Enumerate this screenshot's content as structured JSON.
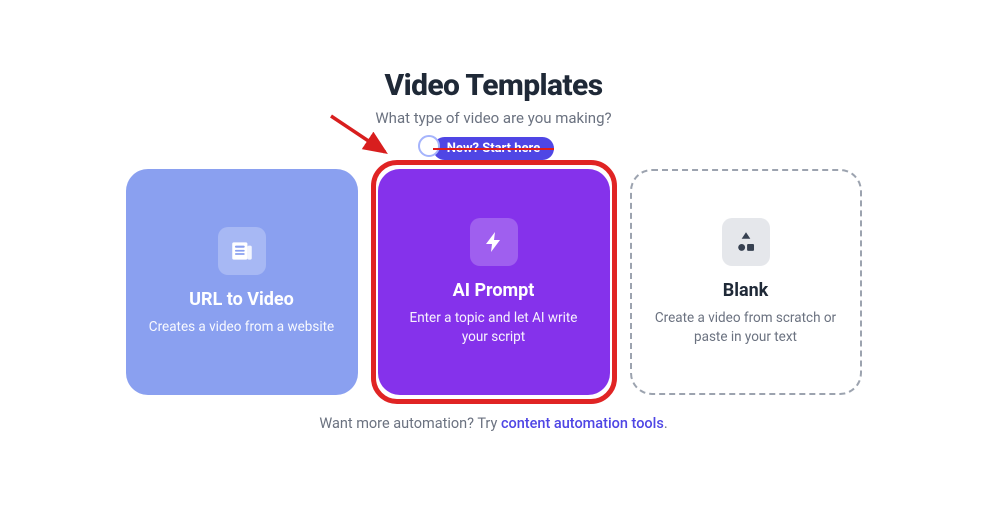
{
  "header": {
    "title": "Video Templates",
    "subtitle": "What type of video are you making?",
    "badge": "New? Start here"
  },
  "cards": {
    "url": {
      "title": "URL to Video",
      "description": "Creates a video from a website",
      "icon": "newspaper-icon"
    },
    "ai": {
      "title": "AI Prompt",
      "description": "Enter a topic and let AI write your script",
      "icon": "lightning-icon"
    },
    "blank": {
      "title": "Blank",
      "description": "Create a video from scratch or paste in your text",
      "icon": "shapes-icon"
    }
  },
  "footer": {
    "prefix": "Want more automation? Try ",
    "link": "content automation tools",
    "suffix": "."
  },
  "annotation": {
    "highlight_target": "ai",
    "arrow_color": "#d81e1e"
  }
}
